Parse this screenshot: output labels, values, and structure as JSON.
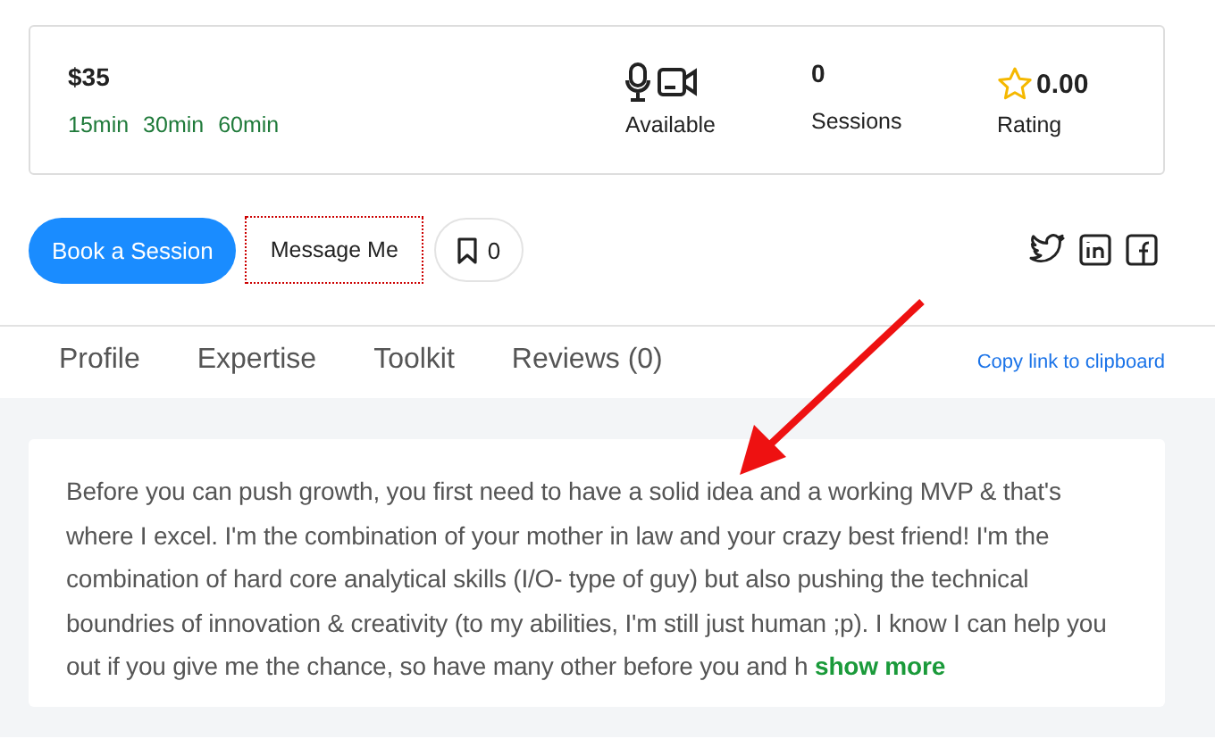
{
  "summary": {
    "price": "$35",
    "durations": [
      "15min",
      "30min",
      "60min"
    ],
    "availability": "Available",
    "sessions_count": "0",
    "sessions_label": "Sessions",
    "rating_value": "0.00",
    "rating_label": "Rating"
  },
  "actions": {
    "book": "Book a Session",
    "message": "Message Me",
    "bookmark_count": "0"
  },
  "tabs": [
    {
      "label": "Profile",
      "selected": false
    },
    {
      "label": "Expertise",
      "selected": false
    },
    {
      "label": "Toolkit",
      "selected": false
    },
    {
      "label": "Reviews (0)",
      "selected": false
    }
  ],
  "copy_link": "Copy link to clipboard",
  "bio": {
    "text": "Before you can push growth, you first need to have a solid idea and a working MVP & that's where I excel. I'm the combination of your mother in law and your crazy best friend! I'm the combination of hard core analytical skills (I/O- type of guy) but also pushing the technical boundries of innovation & creativity (to my abilities, I'm still just human ;p). I know I can help you out if you give me the chance, so have many other before you and h",
    "more": "show more"
  }
}
